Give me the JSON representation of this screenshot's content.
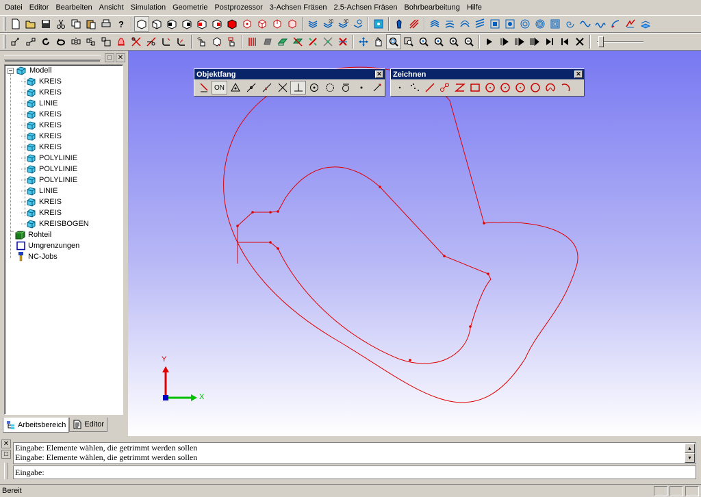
{
  "menu": [
    "Datei",
    "Editor",
    "Bearbeiten",
    "Ansicht",
    "Simulation",
    "Geometrie",
    "Postprozessor",
    "3-Achsen Fräsen",
    "2.5-Achsen Fräsen",
    "Bohrbearbeitung",
    "Hilfe"
  ],
  "tree": {
    "root": "Modell",
    "children": [
      "KREIS",
      "KREIS",
      "LINIE",
      "KREIS",
      "KREIS",
      "KREIS",
      "KREIS",
      "POLYLINIE",
      "POLYLINIE",
      "POLYLINIE",
      "LINIE",
      "KREIS",
      "KREIS",
      "KREISBOGEN"
    ],
    "others": [
      "Rohteil",
      "Umgrenzungen",
      "NC-Jobs"
    ]
  },
  "tabs": {
    "workspace": "Arbeitsbereich",
    "editor": "Editor"
  },
  "floating": {
    "objektfang": {
      "title": "Objektfang",
      "on_label": "ON"
    },
    "zeichnen": {
      "title": "Zeichnen"
    }
  },
  "axes": {
    "y": "Y",
    "x": "X"
  },
  "command": {
    "history": [
      "Eingabe: Elemente wählen, die getrimmt werden sollen",
      "Eingabe: Elemente wählen, die getrimmt werden sollen"
    ],
    "prompt": "Eingabe:"
  },
  "status": "Bereit",
  "colors": {
    "geometry": "#e00000",
    "axis_y": "#e00000",
    "axis_x": "#00c000",
    "title_bar": "#0a246a"
  }
}
